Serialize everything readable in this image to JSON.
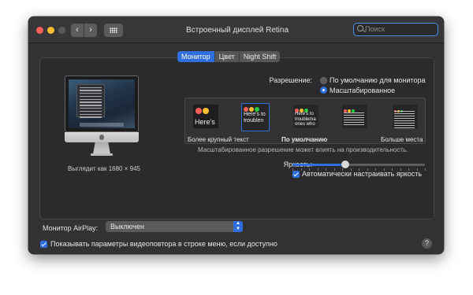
{
  "window": {
    "title": "Встроенный дисплей Retina",
    "nav_back": "‹",
    "nav_forward": "›"
  },
  "search": {
    "placeholder": "Поиск",
    "value": ""
  },
  "tabs": [
    {
      "label": "Монитор",
      "active": true
    },
    {
      "label": "Цвет",
      "active": false
    },
    {
      "label": "Night Shift",
      "active": false
    }
  ],
  "display": {
    "looks_like": "Выглядит как 1680 × 945"
  },
  "resolution": {
    "label": "Разрешение:",
    "option_default": "По умолчанию для монитора",
    "option_scaled": "Масштабированное",
    "selected": "Масштабированное"
  },
  "scaling": {
    "thumb_text_1": "Here's",
    "thumb_text_2": "Here's to troublen",
    "thumb_text_3": "Here's to troublema ones who",
    "caption_left": "Более крупный текст",
    "caption_default": "По умолчанию",
    "caption_right": "Больше места",
    "selected_index": 1,
    "warning": "Масштабированное разрешение может влиять на производительность."
  },
  "brightness": {
    "label": "Яркость:",
    "level_percent": 40,
    "auto_label": "Автоматически настраивать яркость",
    "auto_checked": true
  },
  "airplay": {
    "label": "Монитор AirPlay:",
    "value": "Выключен"
  },
  "mirroring": {
    "label": "Показывать параметры видеоповтора в строке меню, если доступно",
    "checked": true
  },
  "help": {
    "label": "?"
  },
  "colors": {
    "accent": "#2f6fdd",
    "close": "#fe5f57",
    "minimize": "#febc2e",
    "window_bg": "#323234"
  }
}
